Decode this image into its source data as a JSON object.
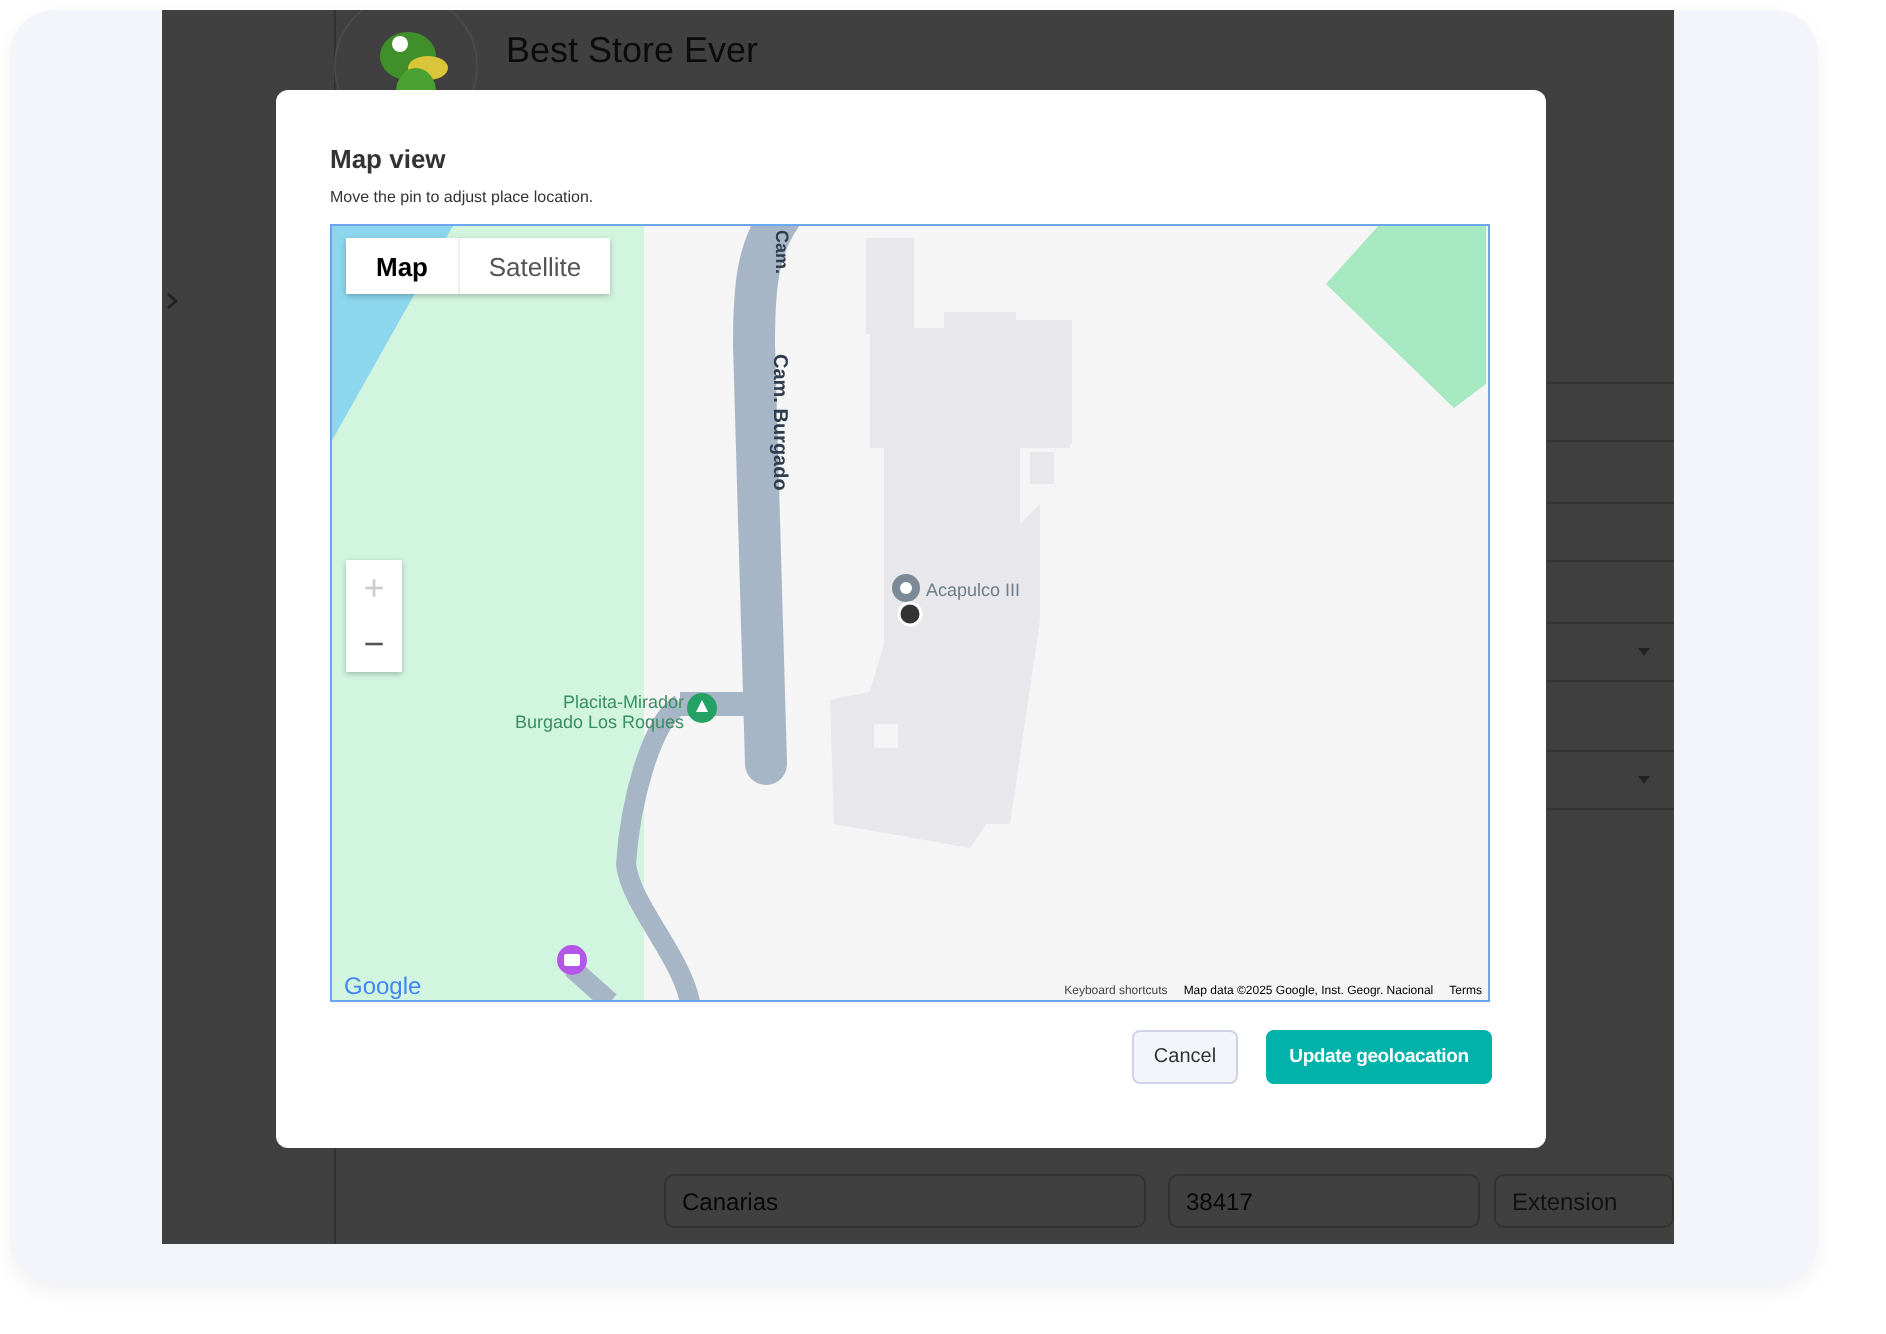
{
  "app": {
    "store_name": "Best Store Ever",
    "address_fields": [
      {
        "value": "Canarias"
      },
      {
        "value": "38417"
      },
      {
        "placeholder": "Extension"
      }
    ]
  },
  "modal": {
    "title": "Map view",
    "subtitle": "Move the pin to adjust place location.",
    "map": {
      "map_types": [
        {
          "label": "Map",
          "selected": true
        },
        {
          "label": "Satellite",
          "selected": false
        }
      ],
      "zoom_in": {
        "label": "+",
        "disabled": true
      },
      "zoom_out": {
        "label": "−",
        "disabled": false
      },
      "road_labels": [
        "Cam.",
        "Cam. Burgado"
      ],
      "place_label": "Acapulco III",
      "park_label": "Placita-Mirador Burgado Los Roques",
      "logo": "Google",
      "footer": [
        "Keyboard shortcuts",
        "Map data ©2025 Google, Inst. Geogr. Nacional",
        "Terms"
      ]
    },
    "buttons": [
      {
        "label": "Cancel",
        "kind": "secondary"
      },
      {
        "label": "Update geoloacation",
        "kind": "primary"
      }
    ]
  }
}
